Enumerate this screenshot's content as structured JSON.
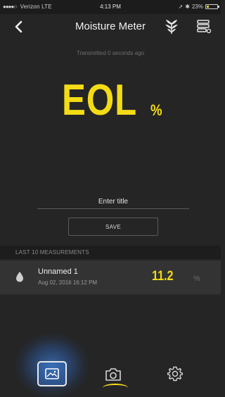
{
  "status_bar": {
    "carrier": "Verizon  LTE",
    "time": "4:13 PM",
    "battery_text": "23%",
    "battery_level": 0.23
  },
  "nav": {
    "title": "Moisture Meter",
    "back_icon": "chevron-left-icon",
    "plant_icon": "leaves-icon",
    "device_icon": "device-list-icon"
  },
  "transmitted_text": "Transmitted 0 seconds ago",
  "reading": {
    "value": "EOL",
    "unit": "%"
  },
  "title_input": {
    "placeholder": "Enter title",
    "value": ""
  },
  "save_label": "SAVE",
  "measurements": {
    "header": "LAST 10 MEASUREMENTS",
    "items": [
      {
        "name": "Unnamed 1",
        "date": "Aug 02, 2016 16:12 PM",
        "value": "11.2",
        "unit": "%"
      }
    ]
  },
  "tabs": [
    {
      "icon": "gallery-icon",
      "active": true
    },
    {
      "icon": "camera-icon",
      "active": false
    },
    {
      "icon": "gear-icon",
      "active": false
    }
  ],
  "colors": {
    "accent": "#f4dc15",
    "background": "#252525",
    "row_background": "#333333",
    "glow": "#4696ff"
  }
}
